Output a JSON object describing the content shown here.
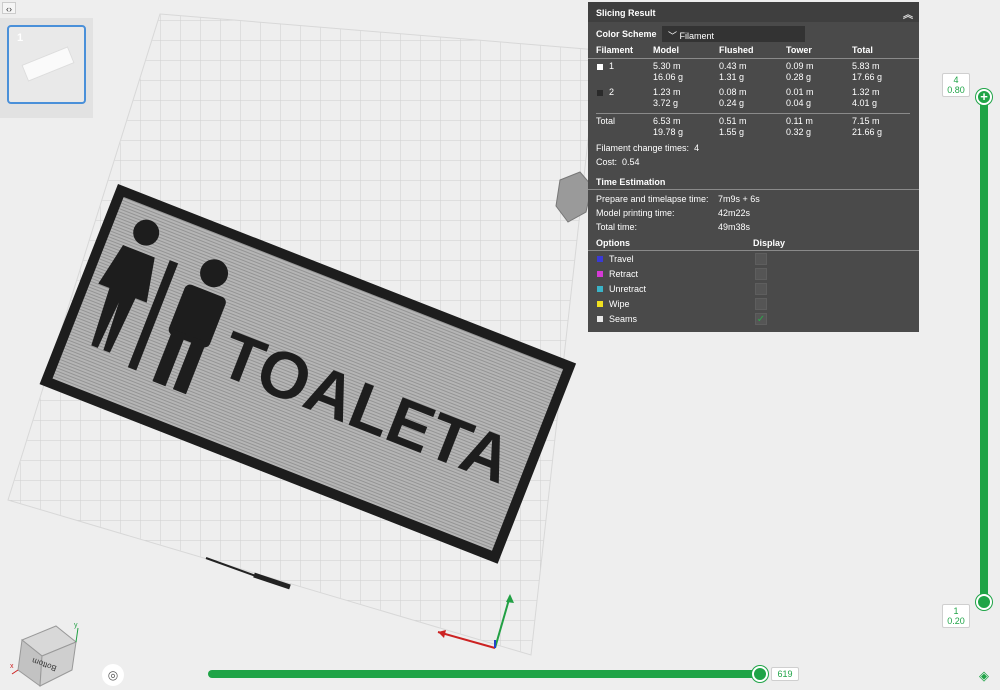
{
  "plate_list": {
    "items": [
      {
        "number": "1"
      }
    ]
  },
  "scene": {
    "model_text": "TOALETA"
  },
  "slicing_result": {
    "title": "Slicing Result",
    "color_scheme_label": "Color Scheme",
    "color_scheme_value": "Filament",
    "headers": [
      "Filament",
      "Model",
      "Flushed",
      "Tower",
      "Total"
    ],
    "rows": [
      {
        "filament": "1",
        "color": "#ffffff",
        "model": [
          "5.30 m",
          "16.06 g"
        ],
        "flushed": [
          "0.43 m",
          "1.31 g"
        ],
        "tower": [
          "0.09 m",
          "0.28 g"
        ],
        "total": [
          "5.83 m",
          "17.66 g"
        ]
      },
      {
        "filament": "2",
        "color": "#2a2a2a",
        "model": [
          "1.23 m",
          "3.72 g"
        ],
        "flushed": [
          "0.08 m",
          "0.24 g"
        ],
        "tower": [
          "0.01 m",
          "0.04 g"
        ],
        "total": [
          "1.32 m",
          "4.01 g"
        ]
      },
      {
        "filament": "Total",
        "color": null,
        "model": [
          "6.53 m",
          "19.78 g"
        ],
        "flushed": [
          "0.51 m",
          "1.55 g"
        ],
        "tower": [
          "0.11 m",
          "0.32 g"
        ],
        "total": [
          "7.15 m",
          "21.66 g"
        ]
      }
    ],
    "filament_change_label": "Filament change times:",
    "filament_change_value": "4",
    "cost_label": "Cost:",
    "cost_value": "0.54",
    "time_title": "Time Estimation",
    "prepare_label": "Prepare and timelapse time:",
    "prepare_value": "7m9s + 6s",
    "printing_label": "Model printing time:",
    "printing_value": "42m22s",
    "total_time_label": "Total time:",
    "total_time_value": "49m38s",
    "options_label": "Options",
    "display_label": "Display",
    "options": [
      {
        "label": "Travel",
        "color": "#3a3ad6",
        "checked": false
      },
      {
        "label": "Retract",
        "color": "#d63ad6",
        "checked": false
      },
      {
        "label": "Unretract",
        "color": "#3ab4c8",
        "checked": false
      },
      {
        "label": "Wipe",
        "color": "#f0e020",
        "checked": false
      },
      {
        "label": "Seams",
        "color": "#e8e8e8",
        "checked": true
      }
    ]
  },
  "layer_slider": {
    "top_layer": "4",
    "top_height": "0.80",
    "bottom_layer": "1",
    "bottom_height": "0.20"
  },
  "move_slider": {
    "value": "619"
  },
  "axis_cube": {
    "face_label": "Bottom",
    "x": "x",
    "y": "y"
  }
}
